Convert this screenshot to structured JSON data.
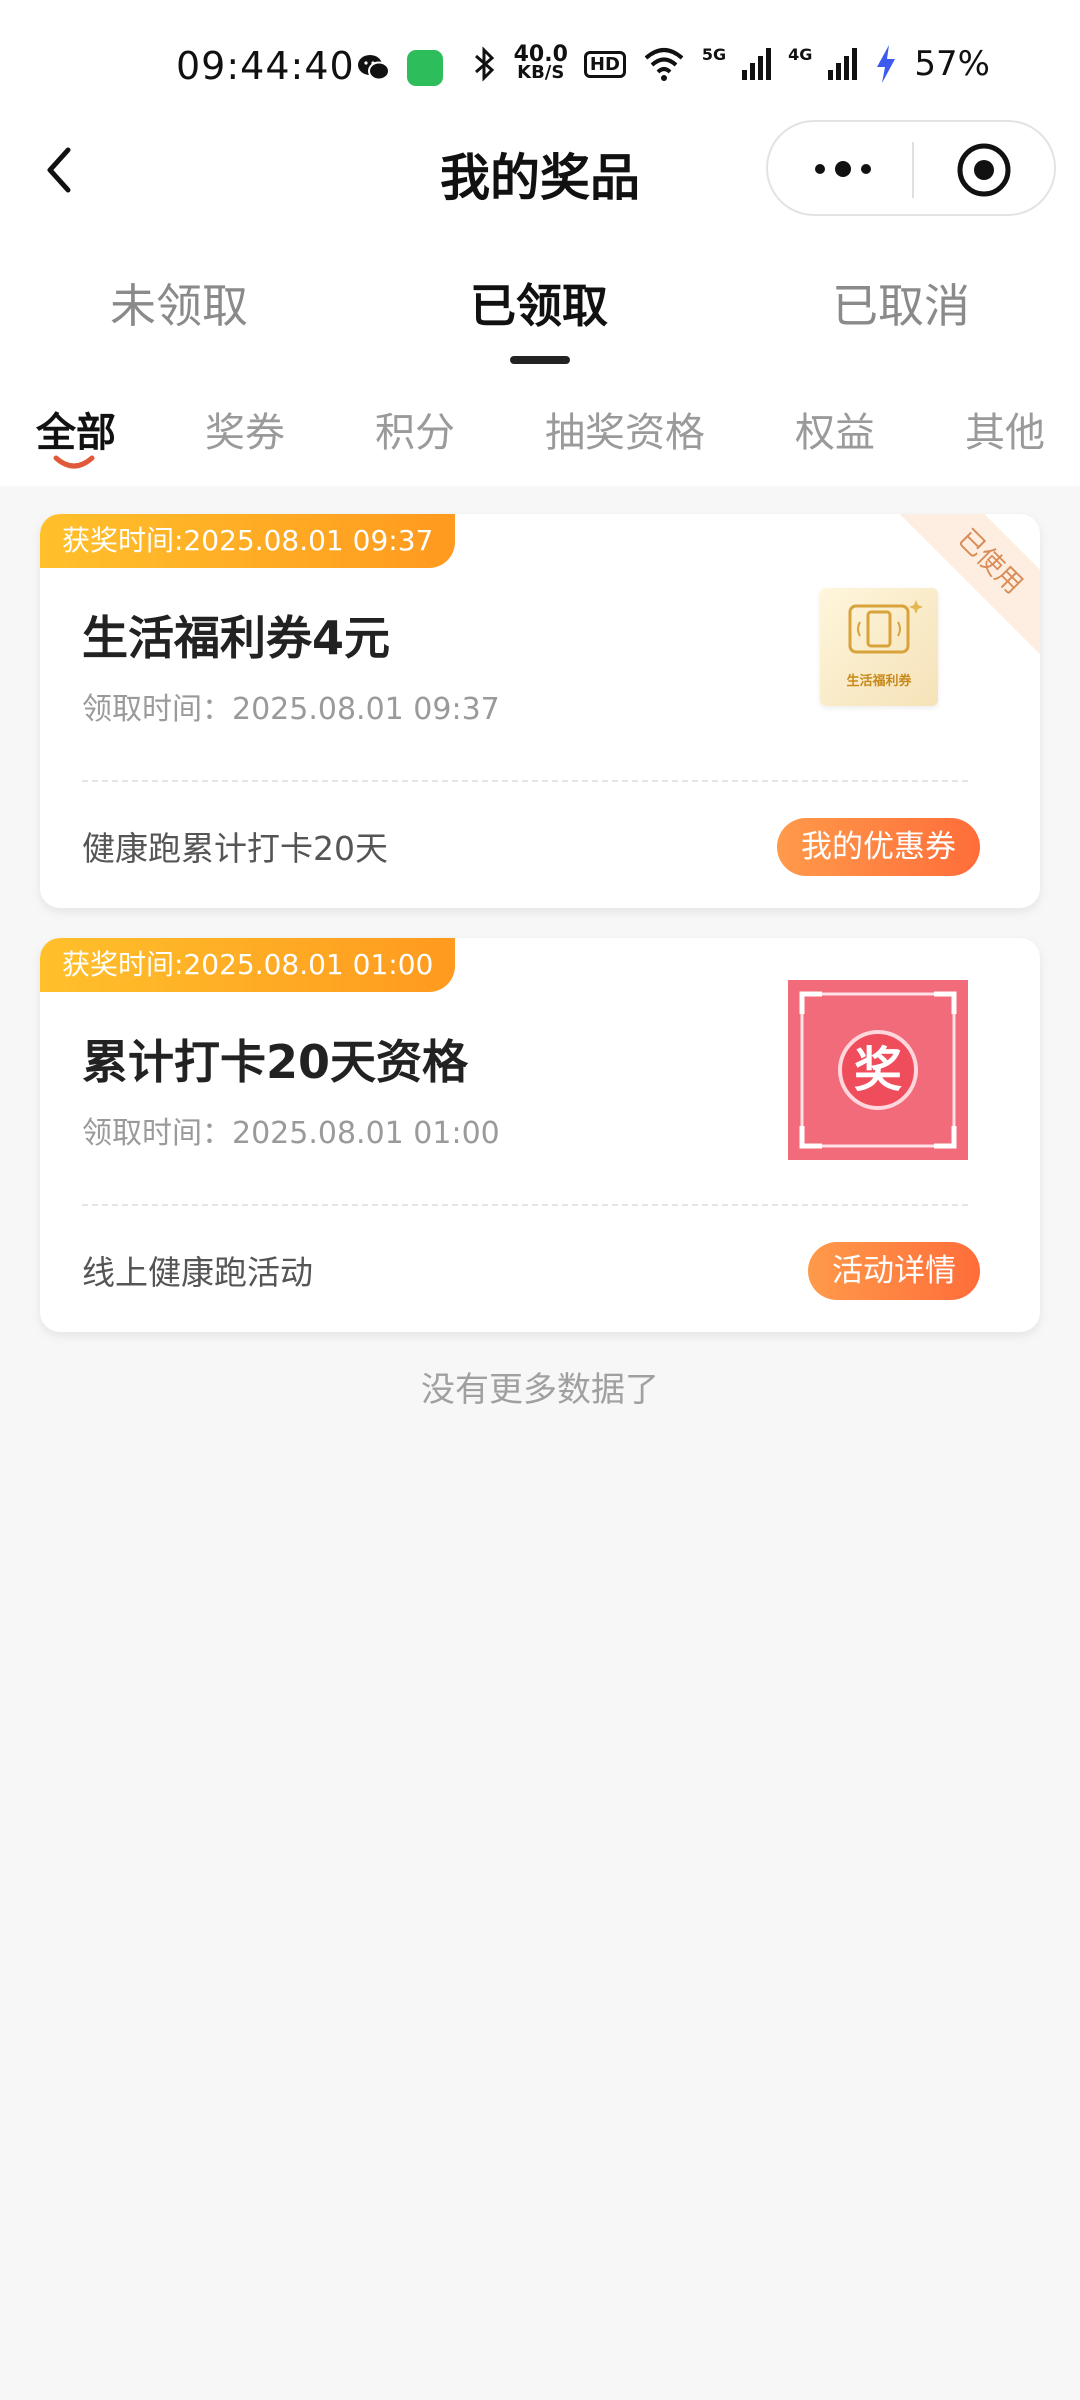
{
  "status_bar": {
    "time": "09:44:40",
    "net_speed_value": "40.0",
    "net_speed_unit": "KB/S",
    "hd_label": "HD",
    "net_5g": "5G",
    "net_4g": "4G",
    "battery": "57%"
  },
  "nav": {
    "title": "我的奖品"
  },
  "status_tabs": [
    {
      "label": "未领取",
      "active": false
    },
    {
      "label": "已领取",
      "active": true
    },
    {
      "label": "已取消",
      "active": false
    }
  ],
  "category_tabs": [
    {
      "label": "全部",
      "active": true
    },
    {
      "label": "奖券",
      "active": false
    },
    {
      "label": "积分",
      "active": false
    },
    {
      "label": "抽奖资格",
      "active": false
    },
    {
      "label": "权益",
      "active": false
    },
    {
      "label": "其他",
      "active": false
    }
  ],
  "cards": [
    {
      "badge": "获奖时间:2025.08.01 09:37",
      "title": "生活福利券4元",
      "claim_time": "领取时间：2025.08.01 09:37",
      "source": "健康跑累计打卡20天",
      "button": "我的优惠券",
      "stamp": "已使用",
      "image_label": "生活福利券"
    },
    {
      "badge": "获奖时间:2025.08.01 01:00",
      "title": "累计打卡20天资格",
      "claim_time": "领取时间：2025.08.01 01:00",
      "source": "线上健康跑活动",
      "button": "活动详情",
      "image_char": "奖"
    }
  ],
  "footer": {
    "no_more": "没有更多数据了"
  },
  "colors": {
    "badge_gradient": [
      "#ffc02b",
      "#ff9a1f"
    ],
    "button_gradient": [
      "#ff9a4a",
      "#ff6d3a"
    ],
    "active_smile": "#e05a3a",
    "background": "#f7f7f7"
  }
}
